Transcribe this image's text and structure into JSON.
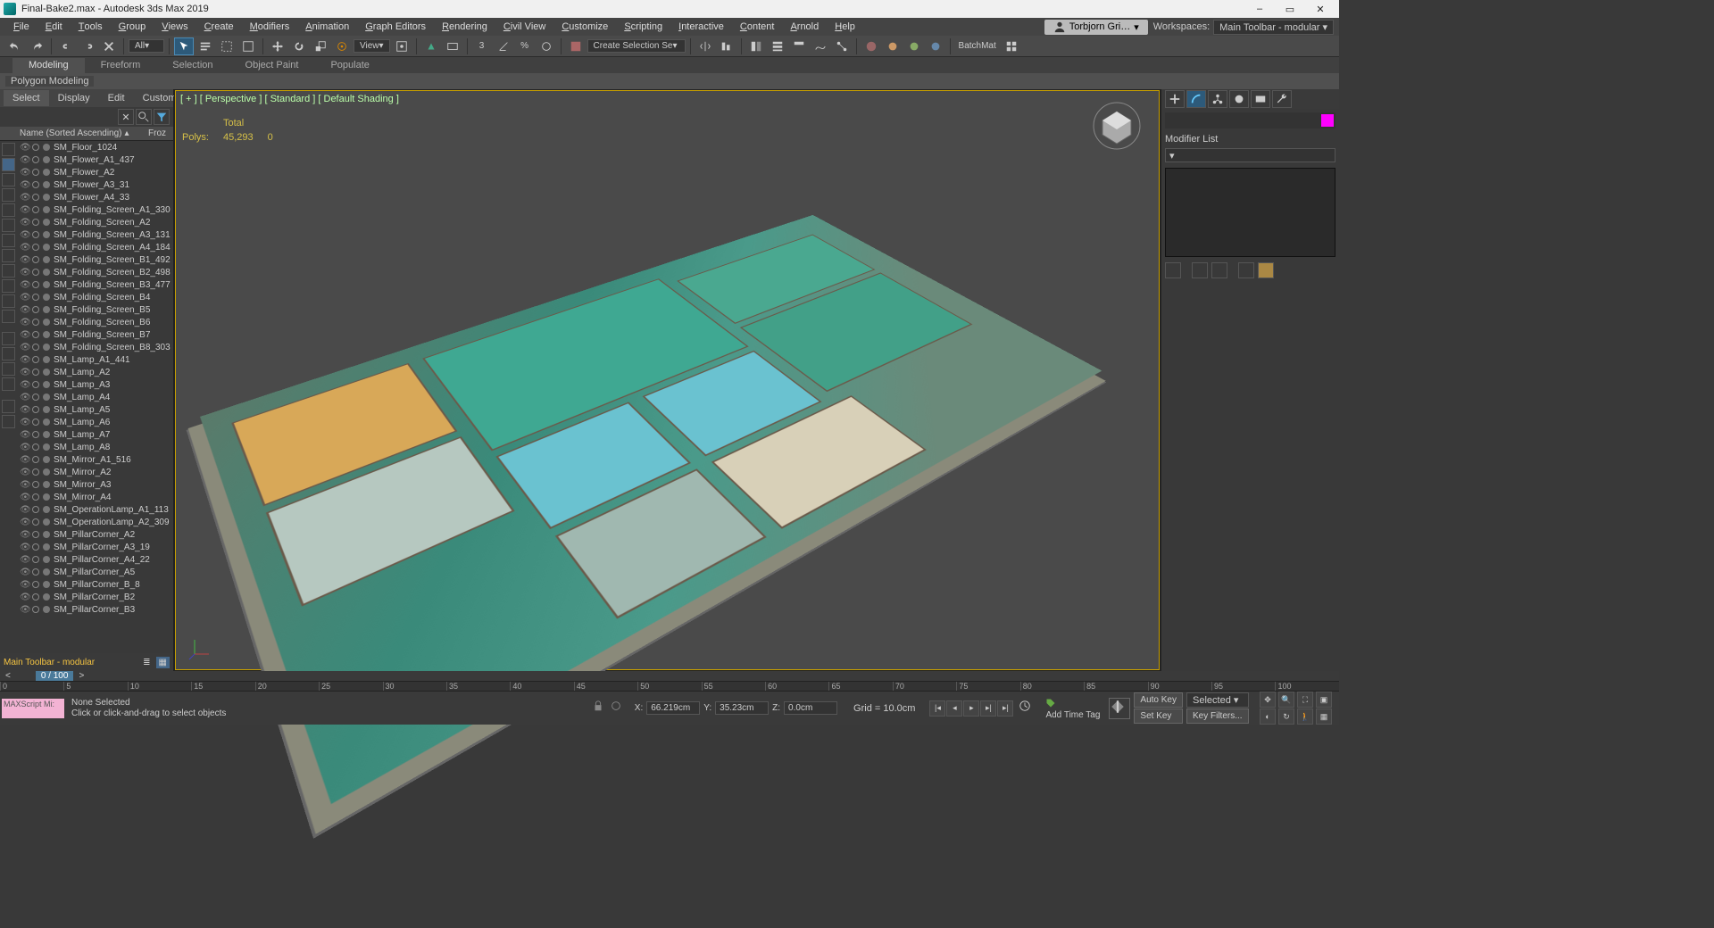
{
  "titlebar": {
    "title": "Final-Bake2.max - Autodesk 3ds Max 2019"
  },
  "menubar": {
    "items": [
      "File",
      "Edit",
      "Tools",
      "Group",
      "Views",
      "Create",
      "Modifiers",
      "Animation",
      "Graph Editors",
      "Rendering",
      "Civil View",
      "Customize",
      "Scripting",
      "Interactive",
      "Content",
      "Arnold",
      "Help"
    ],
    "signin": "Torbjorn Gri…",
    "workspaces_label": "Workspaces:",
    "workspaces_value": "Main Toolbar - modular"
  },
  "toolbar": {
    "all": "All",
    "view": "View",
    "selset": "Create Selection Se",
    "batchmat": "BatchMat"
  },
  "ribbon": {
    "tabs": [
      "Modeling",
      "Freeform",
      "Selection",
      "Object Paint",
      "Populate"
    ],
    "subtab": "Polygon Modeling"
  },
  "scene_explorer": {
    "tabs": [
      "Select",
      "Display",
      "Edit",
      "Customize"
    ],
    "header_name": "Name (Sorted Ascending)",
    "header_froz": "Froz",
    "items": [
      "SM_Floor_1024",
      "SM_Flower_A1_437",
      "SM_Flower_A2",
      "SM_Flower_A3_31",
      "SM_Flower_A4_33",
      "SM_Folding_Screen_A1_330",
      "SM_Folding_Screen_A2",
      "SM_Folding_Screen_A3_131",
      "SM_Folding_Screen_A4_184",
      "SM_Folding_Screen_B1_492",
      "SM_Folding_Screen_B2_498",
      "SM_Folding_Screen_B3_477",
      "SM_Folding_Screen_B4",
      "SM_Folding_Screen_B5",
      "SM_Folding_Screen_B6",
      "SM_Folding_Screen_B7",
      "SM_Folding_Screen_B8_303",
      "SM_Lamp_A1_441",
      "SM_Lamp_A2",
      "SM_Lamp_A3",
      "SM_Lamp_A4",
      "SM_Lamp_A5",
      "SM_Lamp_A6",
      "SM_Lamp_A7",
      "SM_Lamp_A8",
      "SM_Mirror_A1_516",
      "SM_Mirror_A2",
      "SM_Mirror_A3",
      "SM_Mirror_A4",
      "SM_OperationLamp_A1_113",
      "SM_OperationLamp_A2_309",
      "SM_PillarCorner_A2",
      "SM_PillarCorner_A3_19",
      "SM_PillarCorner_A4_22",
      "SM_PillarCorner_A5",
      "SM_PillarCorner_B_8",
      "SM_PillarCorner_B2",
      "SM_PillarCorner_B3"
    ],
    "footer_label": "Main Toolbar - modular"
  },
  "viewport": {
    "label": "[ + ] [ Perspective ] [ Standard ] [ Default Shading ]",
    "stats_total": "Total",
    "stats_polys_label": "Polys:",
    "stats_polys": "45,293",
    "stats_zero": "0"
  },
  "cmdpanel": {
    "modlist": "Modifier List"
  },
  "timeline": {
    "frame": "0 / 100",
    "ticks": [
      "0",
      "5",
      "10",
      "15",
      "20",
      "25",
      "30",
      "35",
      "40",
      "45",
      "50",
      "55",
      "60",
      "65",
      "70",
      "75",
      "80",
      "85",
      "90",
      "95",
      "100"
    ]
  },
  "status": {
    "maxscript": "MAXScript Mi:",
    "none_selected": "None Selected",
    "prompt": "Click or click-and-drag to select objects",
    "x_label": "X:",
    "x_val": "66.219cm",
    "y_label": "Y:",
    "y_val": "35.23cm",
    "z_label": "Z:",
    "z_val": "0.0cm",
    "grid": "Grid = 10.0cm",
    "addtag": "Add Time Tag",
    "autokey": "Auto Key",
    "setkey": "Set Key",
    "selected": "Selected",
    "keyfilters": "Key Filters..."
  }
}
